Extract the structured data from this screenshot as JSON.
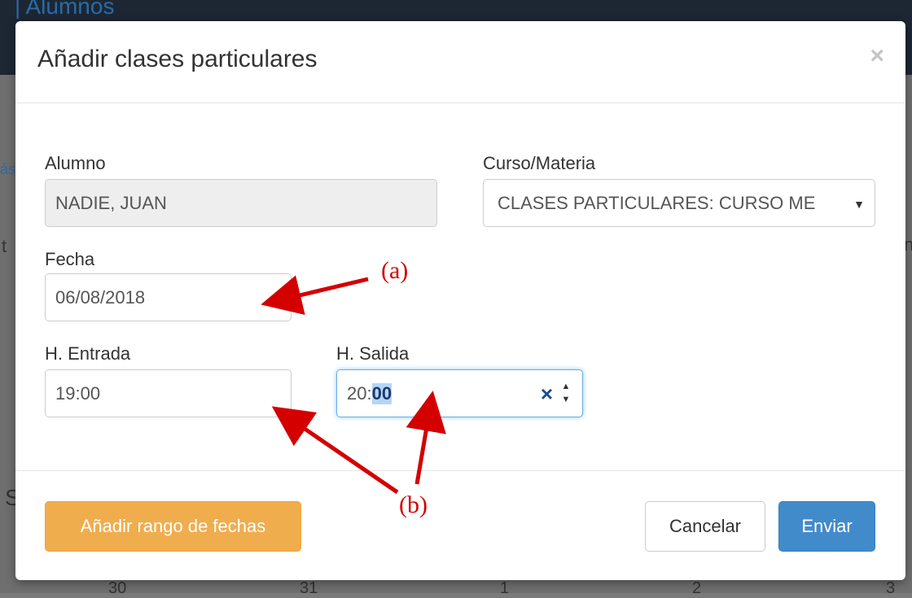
{
  "background": {
    "header_title": "| Alumnos",
    "calendar_days": [
      "30",
      "31",
      "1",
      "2",
      "3"
    ],
    "side_left_1": "ás",
    "side_left_2": "t",
    "side_left_3": "S",
    "side_right": "n"
  },
  "modal": {
    "title": "Añadir clases particulares",
    "close": "×",
    "fields": {
      "alumno_label": "Alumno",
      "alumno_value": "NADIE, JUAN",
      "curso_label": "Curso/Materia",
      "curso_value": "CLASES PARTICULARES: CURSO ME",
      "fecha_label": "Fecha",
      "fecha_value": "06/08/2018",
      "entrada_label": "H. Entrada",
      "entrada_value": "19:00",
      "salida_label": "H. Salida",
      "salida_hour": "20:",
      "salida_minutes": "00"
    },
    "buttons": {
      "range": "Añadir rango de fechas",
      "cancel": "Cancelar",
      "submit": "Enviar"
    }
  },
  "annotations": {
    "a": "(a)",
    "b": "(b)"
  },
  "colors": {
    "warning": "#f0ad4e",
    "primary": "#428bca",
    "annotation": "#d40000"
  }
}
